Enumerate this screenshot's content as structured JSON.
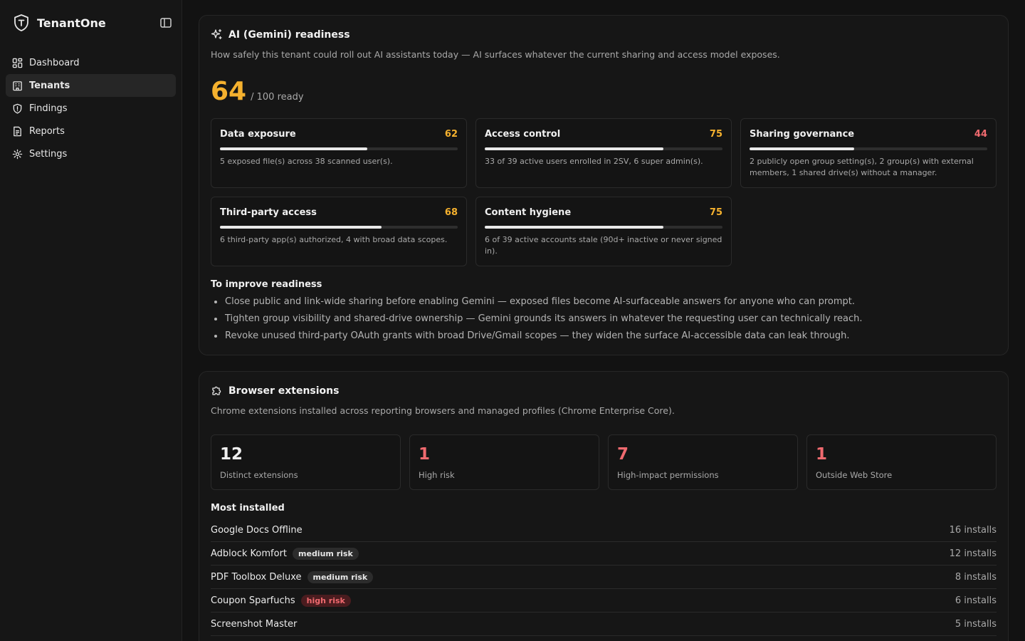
{
  "app": {
    "name": "TenantOne"
  },
  "sidebar": {
    "items": [
      {
        "label": "Dashboard",
        "icon": "dashboard-icon",
        "active": false
      },
      {
        "label": "Tenants",
        "icon": "building-icon",
        "active": true
      },
      {
        "label": "Findings",
        "icon": "shield-icon",
        "active": false
      },
      {
        "label": "Reports",
        "icon": "file-icon",
        "active": false
      },
      {
        "label": "Settings",
        "icon": "gear-icon",
        "active": false
      }
    ]
  },
  "colors": {
    "accent_orange": "#f5b12e",
    "danger": "#f06a6f",
    "background": "#121212",
    "card": "#161616"
  },
  "ai_readiness": {
    "title": "AI (Gemini) readiness",
    "subtitle": "How safely this tenant could roll out AI assistants today — AI surfaces whatever the current sharing and access model exposes.",
    "score": "64",
    "score_suffix": "/ 100 ready",
    "metrics": [
      {
        "name": "Data exposure",
        "score": "62",
        "value": 62,
        "color": "#f5b12e",
        "desc": "5 exposed file(s) across 38 scanned user(s)."
      },
      {
        "name": "Access control",
        "score": "75",
        "value": 75,
        "color": "#f5b12e",
        "desc": "33 of 39 active users enrolled in 2SV, 6 super admin(s)."
      },
      {
        "name": "Sharing governance",
        "score": "44",
        "value": 44,
        "color": "#f06a6f",
        "desc": "2 publicly open group setting(s), 2 group(s) with external members, 1 shared drive(s) without a manager."
      },
      {
        "name": "Third-party access",
        "score": "68",
        "value": 68,
        "color": "#f5b12e",
        "desc": "6 third-party app(s) authorized, 4 with broad data scopes."
      },
      {
        "name": "Content hygiene",
        "score": "75",
        "value": 75,
        "color": "#f5b12e",
        "desc": "6 of 39 active accounts stale (90d+ inactive or never signed in)."
      }
    ],
    "improve_title": "To improve readiness",
    "improve_items": [
      "Close public and link-wide sharing before enabling Gemini — exposed files become AI-surfaceable answers for anyone who can prompt.",
      "Tighten group visibility and shared-drive ownership — Gemini grounds its answers in whatever the requesting user can technically reach.",
      "Revoke unused third-party OAuth grants with broad Drive/Gmail scopes — they widen the surface AI-accessible data can leak through."
    ]
  },
  "extensions": {
    "title": "Browser extensions",
    "subtitle": "Chrome extensions installed across reporting browsers and managed profiles (Chrome Enterprise Core).",
    "stats": [
      {
        "value": "12",
        "label": "Distinct extensions",
        "color": "#f0f0f0"
      },
      {
        "value": "1",
        "label": "High risk",
        "color": "#f06a6f"
      },
      {
        "value": "7",
        "label": "High-impact permissions",
        "color": "#f06a6f"
      },
      {
        "value": "1",
        "label": "Outside Web Store",
        "color": "#f06a6f"
      }
    ],
    "most_installed_title": "Most installed",
    "rows": [
      {
        "name": "Google Docs Offline",
        "risk": "",
        "installs": "16 installs"
      },
      {
        "name": "Adblock Komfort",
        "risk": "medium risk",
        "installs": "12 installs"
      },
      {
        "name": "PDF Toolbox Deluxe",
        "risk": "medium risk",
        "installs": "8 installs"
      },
      {
        "name": "Coupon Sparfuchs",
        "risk": "high risk",
        "installs": "6 installs"
      },
      {
        "name": "Screenshot Master",
        "risk": "",
        "installs": "5 installs"
      }
    ]
  }
}
